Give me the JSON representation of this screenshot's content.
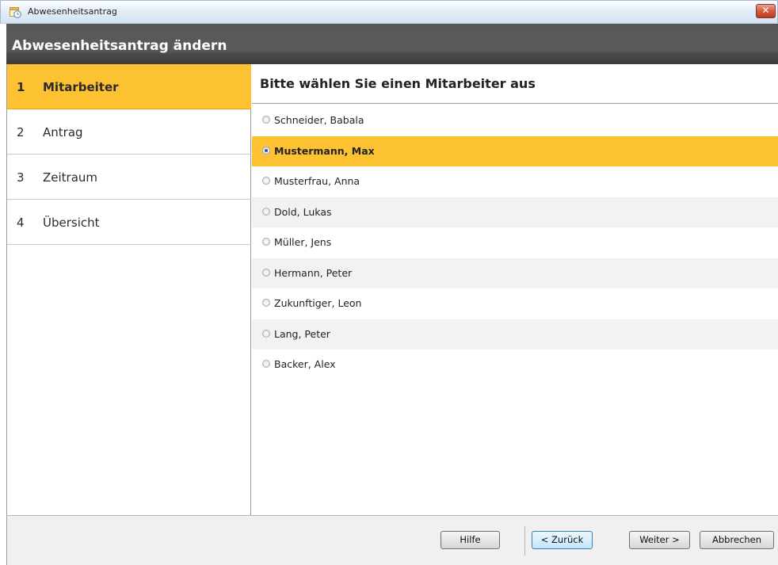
{
  "window": {
    "title": "Abwesenheitsantrag",
    "close_label": "✕"
  },
  "header": {
    "title": "Abwesenheitsantrag ändern"
  },
  "steps": [
    {
      "num": "1",
      "label": "Mitarbeiter",
      "active": true
    },
    {
      "num": "2",
      "label": "Antrag",
      "active": false
    },
    {
      "num": "3",
      "label": "Zeitraum",
      "active": false
    },
    {
      "num": "4",
      "label": "Übersicht",
      "active": false
    }
  ],
  "main": {
    "heading": "Bitte wählen Sie einen Mitarbeiter aus",
    "employees": [
      {
        "name": "Schneider, Babala",
        "selected": false
      },
      {
        "name": "Mustermann, Max",
        "selected": true
      },
      {
        "name": "Musterfrau, Anna",
        "selected": false
      },
      {
        "name": "Dold, Lukas",
        "selected": false
      },
      {
        "name": "Müller, Jens",
        "selected": false
      },
      {
        "name": "Hermann, Peter",
        "selected": false
      },
      {
        "name": "Zukunftiger, Leon",
        "selected": false
      },
      {
        "name": "Lang, Peter",
        "selected": false
      },
      {
        "name": "Backer, Alex",
        "selected": false
      }
    ]
  },
  "footer": {
    "help": "Hilfe",
    "back": "< Zurück",
    "next": "Weiter >",
    "cancel": "Abbrechen"
  },
  "colors": {
    "accent": "#fcc232",
    "header_bg": "#555555",
    "alt_row": "#f2f2f2"
  }
}
